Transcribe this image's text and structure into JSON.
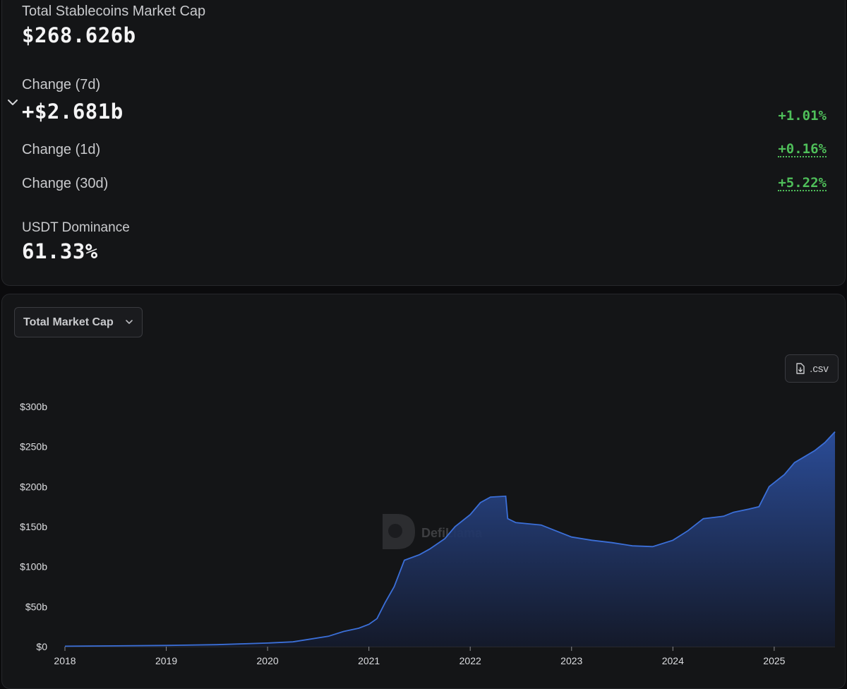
{
  "stats": {
    "market_cap_label": "Total Stablecoins Market Cap",
    "market_cap_value": "$268.626b",
    "change_7d_label": "Change (7d)",
    "change_7d_value": "+$2.681b",
    "change_7d_pct": "+1.01%",
    "change_1d_label": "Change (1d)",
    "change_1d_pct": "+0.16%",
    "change_30d_label": "Change (30d)",
    "change_30d_pct": "+5.22%",
    "dominance_label": "USDT Dominance",
    "dominance_value": "61.33%"
  },
  "controls": {
    "chart_select_value": "Total Market Cap",
    "csv_label": ".csv"
  },
  "watermark": {
    "text": "DefiLlama"
  },
  "colors": {
    "positive": "#4fbf5a",
    "line": "#3b6fd8",
    "fill_top": "#2c4f9e",
    "fill_bottom": "#141a2c"
  },
  "chart_data": {
    "type": "area",
    "title": "",
    "xlabel": "",
    "ylabel": "",
    "x_ticks": [
      "2018",
      "2019",
      "2020",
      "2021",
      "2022",
      "2023",
      "2024",
      "2025"
    ],
    "y_ticks": [
      "$0",
      "$50b",
      "$100b",
      "$150b",
      "$200b",
      "$250b",
      "$300b"
    ],
    "ylim": [
      0,
      300
    ],
    "y_unit": "billions USD",
    "xlim": [
      2018.0,
      2025.6
    ],
    "grid": false,
    "legend": "none",
    "series": [
      {
        "values": [
          [
            2018.0,
            0.5
          ],
          [
            2018.5,
            1.0
          ],
          [
            2019.0,
            1.5
          ],
          [
            2019.5,
            2.5
          ],
          [
            2020.0,
            4.5
          ],
          [
            2020.25,
            6.0
          ],
          [
            2020.4,
            9.0
          ],
          [
            2020.6,
            13.0
          ],
          [
            2020.75,
            19.0
          ],
          [
            2020.9,
            23.0
          ],
          [
            2021.0,
            28.0
          ],
          [
            2021.08,
            35.0
          ],
          [
            2021.16,
            55.0
          ],
          [
            2021.25,
            75.0
          ],
          [
            2021.35,
            108.0
          ],
          [
            2021.5,
            115.0
          ],
          [
            2021.6,
            122.0
          ],
          [
            2021.75,
            135.0
          ],
          [
            2021.85,
            150.0
          ],
          [
            2022.0,
            165.0
          ],
          [
            2022.1,
            180.0
          ],
          [
            2022.2,
            187.0
          ],
          [
            2022.35,
            188.0
          ],
          [
            2022.37,
            160.0
          ],
          [
            2022.45,
            155.0
          ],
          [
            2022.7,
            152.0
          ],
          [
            2022.9,
            142.0
          ],
          [
            2023.0,
            137.0
          ],
          [
            2023.2,
            133.0
          ],
          [
            2023.4,
            130.0
          ],
          [
            2023.6,
            126.0
          ],
          [
            2023.8,
            125.0
          ],
          [
            2024.0,
            133.0
          ],
          [
            2024.15,
            145.0
          ],
          [
            2024.3,
            160.0
          ],
          [
            2024.5,
            163.0
          ],
          [
            2024.6,
            168.0
          ],
          [
            2024.75,
            172.0
          ],
          [
            2024.85,
            175.0
          ],
          [
            2024.95,
            200.0
          ],
          [
            2025.1,
            215.0
          ],
          [
            2025.2,
            230.0
          ],
          [
            2025.4,
            245.0
          ],
          [
            2025.5,
            255.0
          ],
          [
            2025.6,
            268.6
          ]
        ]
      }
    ]
  }
}
